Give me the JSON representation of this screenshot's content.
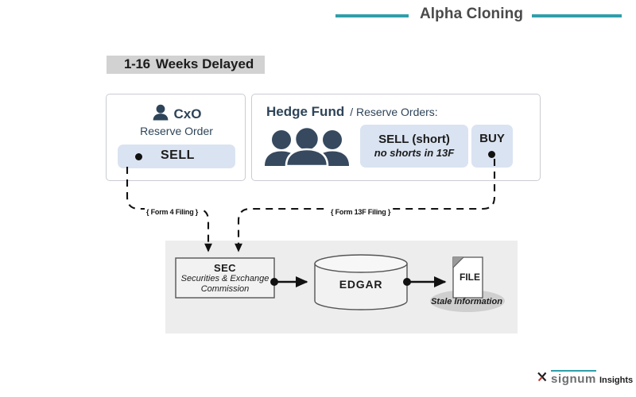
{
  "header": {
    "title": "Alpha Cloning",
    "rule_color": "#2f9faa"
  },
  "section": {
    "heading_prefix": "1-16",
    "heading_suffix": "Weeks Delayed",
    "highlight_color": "#d2d2d2"
  },
  "cxo": {
    "icon": "person-icon",
    "title": "CxO",
    "subtitle": "Reserve Order",
    "order_label": "SELL",
    "pill_color": "#dae3f1"
  },
  "hedge_fund": {
    "icon": "people-group-icon",
    "title": "Hedge Fund",
    "subtitle": "/ Reserve Orders:",
    "sell_label": "SELL (short)",
    "sell_note": "no shorts in 13F",
    "buy_label": "BUY",
    "pill_color": "#dae3f1"
  },
  "flow": {
    "form4_label": "{ Form 4 Filing }",
    "form13f_label": "{ Form 13F Filing }",
    "sec_title": "SEC",
    "sec_subtitle": "Securities & Exchange Commission",
    "edgar_label": "EDGAR",
    "file_label": "FILE",
    "stale_label": "Stale Information",
    "panel_color": "#ededed"
  },
  "footer": {
    "logo_mark": "x-mark-icon",
    "logo_name": "signum",
    "logo_suffix": "Insights",
    "logo_bar_color": "#2f9faa"
  }
}
